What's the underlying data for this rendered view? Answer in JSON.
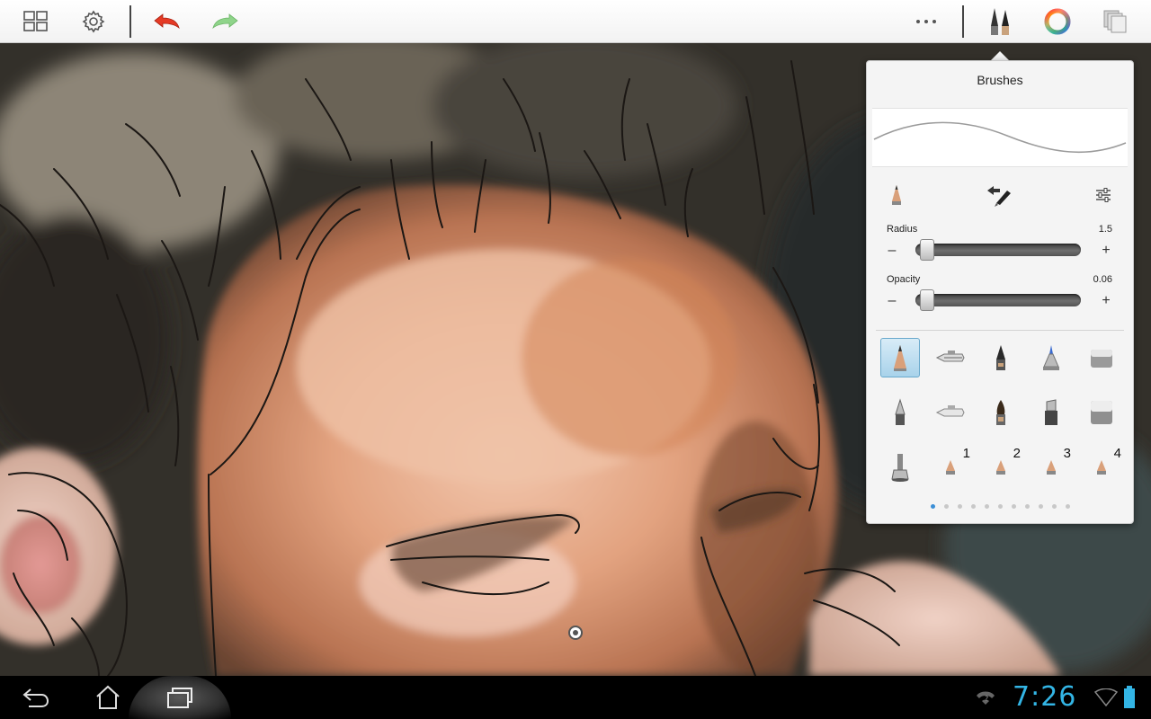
{
  "toolbar": {
    "icons": [
      "gallery-grid-icon",
      "settings-gear-icon",
      "undo-arrow-icon",
      "redo-arrow-icon",
      "more-dots-icon",
      "brushes-icon",
      "color-wheel-icon",
      "layers-icon"
    ],
    "undo_color": "#e53a25",
    "redo_color": "#8fd48a"
  },
  "brushes": {
    "title": "Brushes",
    "radius": {
      "label": "Radius",
      "value": "1.5",
      "level": 0.03
    },
    "opacity": {
      "label": "Opacity",
      "value": "0.06",
      "level": 0.03
    },
    "minus": "–",
    "plus": "+",
    "slots": [
      "1",
      "2",
      "3",
      "4"
    ],
    "page_count": 11,
    "active_page": 0,
    "selected_color": "#a8d2ea"
  },
  "system": {
    "time": "7:26",
    "icons": [
      "back-icon",
      "home-icon",
      "recent-apps-icon",
      "sync-icon",
      "wifi-icon",
      "battery-icon"
    ]
  }
}
